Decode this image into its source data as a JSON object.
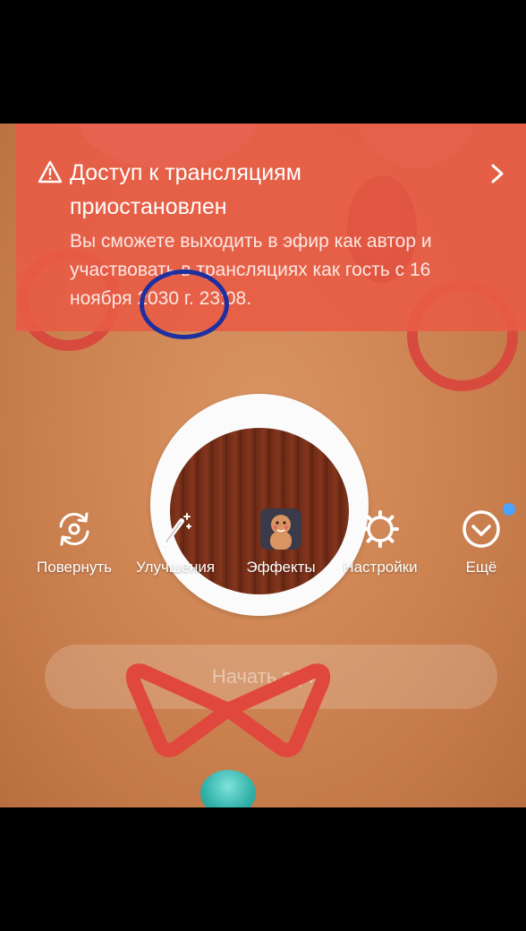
{
  "banner": {
    "title": "Доступ к трансляциям приостановлен",
    "message": "Вы сможете выходить в эфир как автор и участвовать в трансляциях как гость с 16 ноября 2030 г. 23:08.",
    "warning_icon": "warning-triangle-icon",
    "chevron_icon": "chevron-right-icon"
  },
  "toolbar": {
    "items": [
      {
        "label": "Повернуть",
        "icon": "camera-flip-icon"
      },
      {
        "label": "Улучшения",
        "icon": "magic-wand-icon"
      },
      {
        "label": "Эффекты",
        "icon": "effects-thumbnail"
      },
      {
        "label": "Настройки",
        "icon": "gear-icon"
      },
      {
        "label": "Ещё",
        "icon": "chevron-down-circle-icon"
      }
    ]
  },
  "start_button": {
    "label": "Начать эфир"
  },
  "colors": {
    "banner_bg": "#e85c46",
    "annotation": "#1e2fa0",
    "notification_dot": "#4aa3ff"
  }
}
